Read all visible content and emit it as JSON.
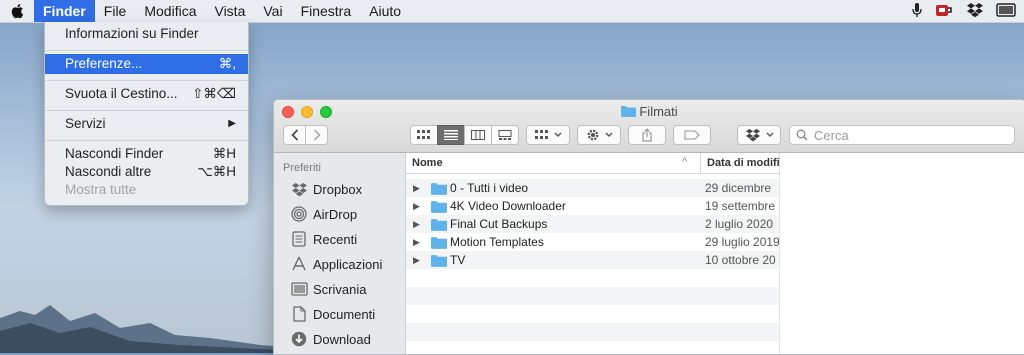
{
  "menubar": {
    "items": [
      {
        "label": "Finder",
        "active": true
      },
      {
        "label": "File"
      },
      {
        "label": "Modifica"
      },
      {
        "label": "Vista"
      },
      {
        "label": "Vai"
      },
      {
        "label": "Finestra"
      },
      {
        "label": "Aiuto"
      }
    ],
    "status_icons": [
      "microphone-icon",
      "coffee-cup-icon",
      "dropbox-icon",
      "display-icon"
    ]
  },
  "finder_menu": {
    "items": [
      {
        "label": "Informazioni su Finder",
        "shortcut": ""
      },
      {
        "label": "Preferenze...",
        "shortcut": "⌘,",
        "selected": true
      },
      {
        "label": "Svuota il Cestino...",
        "shortcut": "⇧⌘⌫"
      },
      {
        "label": "Servizi",
        "shortcut": "▶"
      },
      {
        "label": "Nascondi Finder",
        "shortcut": "⌘H"
      },
      {
        "label": "Nascondi altre",
        "shortcut": "⌥⌘H"
      },
      {
        "label": "Mostra tutte",
        "shortcut": "",
        "disabled": true
      }
    ]
  },
  "window": {
    "title": "Filmati",
    "search_placeholder": "Cerca",
    "sidebar": {
      "heading": "Preferiti",
      "items": [
        {
          "label": "Dropbox",
          "icon": "dropbox-icon"
        },
        {
          "label": "AirDrop",
          "icon": "airdrop-icon"
        },
        {
          "label": "Recenti",
          "icon": "recents-icon"
        },
        {
          "label": "Applicazioni",
          "icon": "applications-icon"
        },
        {
          "label": "Scrivania",
          "icon": "desktop-icon"
        },
        {
          "label": "Documenti",
          "icon": "documents-icon"
        },
        {
          "label": "Download",
          "icon": "download-icon"
        }
      ]
    },
    "list": {
      "col_name": "Nome",
      "col_date": "Data di modifica",
      "rows": [
        {
          "name": "0 - Tutti i video",
          "date": "29 dicembre"
        },
        {
          "name": "4K Video Downloader",
          "date": "19 settembre"
        },
        {
          "name": "Final Cut Backups",
          "date": "2 luglio 2020"
        },
        {
          "name": "Motion Templates",
          "date": "29 luglio 2019"
        },
        {
          "name": "TV",
          "date": "10 ottobre 20"
        }
      ]
    }
  },
  "colors": {
    "accent": "#2f6ee4",
    "folder": "#5fb3ea",
    "close": "#fe5f57",
    "minimize": "#febc2e",
    "zoom": "#28c840"
  }
}
